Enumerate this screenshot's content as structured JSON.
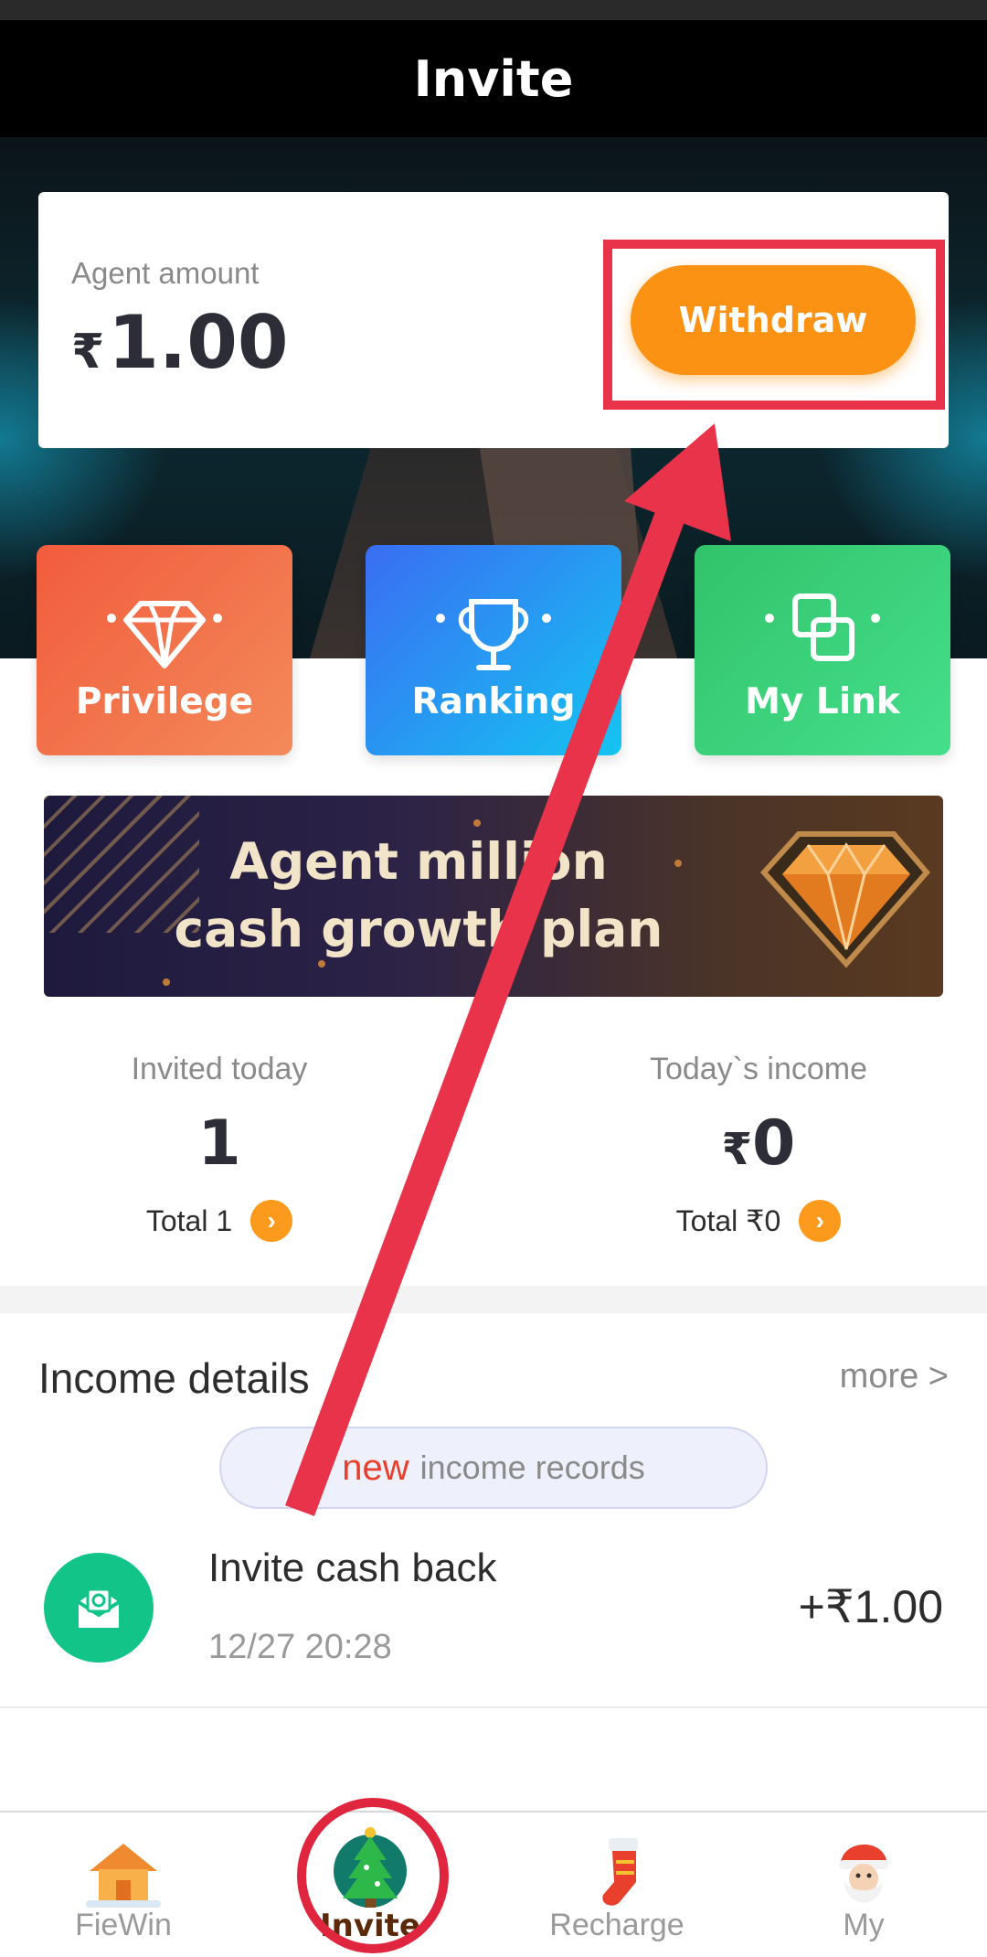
{
  "header": {
    "title": "Invite"
  },
  "agent_card": {
    "label": "Agent amount",
    "currency": "₹",
    "amount": "1.00",
    "withdraw_label": "Withdraw"
  },
  "tiles": [
    {
      "label": "Privilege",
      "icon": "diamond-icon"
    },
    {
      "label": "Ranking",
      "icon": "trophy-icon"
    },
    {
      "label": "My Link",
      "icon": "link-squares-icon"
    }
  ],
  "banner": {
    "line1": "Agent million",
    "line2": "cash growth plan"
  },
  "stats": {
    "invited_today": {
      "label": "Invited today",
      "value": "1",
      "total": "Total 1"
    },
    "today_income": {
      "label": "Today`s income",
      "currency": "₹",
      "value": "0",
      "total": "Total ₹0"
    }
  },
  "income": {
    "title": "Income details",
    "more": "more >",
    "new_word": "new",
    "new_rest": "income records",
    "records": [
      {
        "title": "Invite cash back",
        "time": "12/27 20:28",
        "amount": "+₹1.00",
        "icon": "cash-envelope-icon"
      }
    ]
  },
  "tabbar": [
    {
      "label": "FieWin",
      "icon": "house-icon"
    },
    {
      "label": "Invite",
      "icon": "christmas-tree-icon"
    },
    {
      "label": "Recharge",
      "icon": "stocking-icon"
    },
    {
      "label": "My",
      "icon": "santa-icon"
    }
  ],
  "colors": {
    "accent_orange": "#fb9214",
    "highlight_red": "#e8334a",
    "tile_privilege": "#f25c3c",
    "tile_ranking": "#3a6df2",
    "tile_mylink": "#32c36a",
    "record_green": "#12c487"
  }
}
